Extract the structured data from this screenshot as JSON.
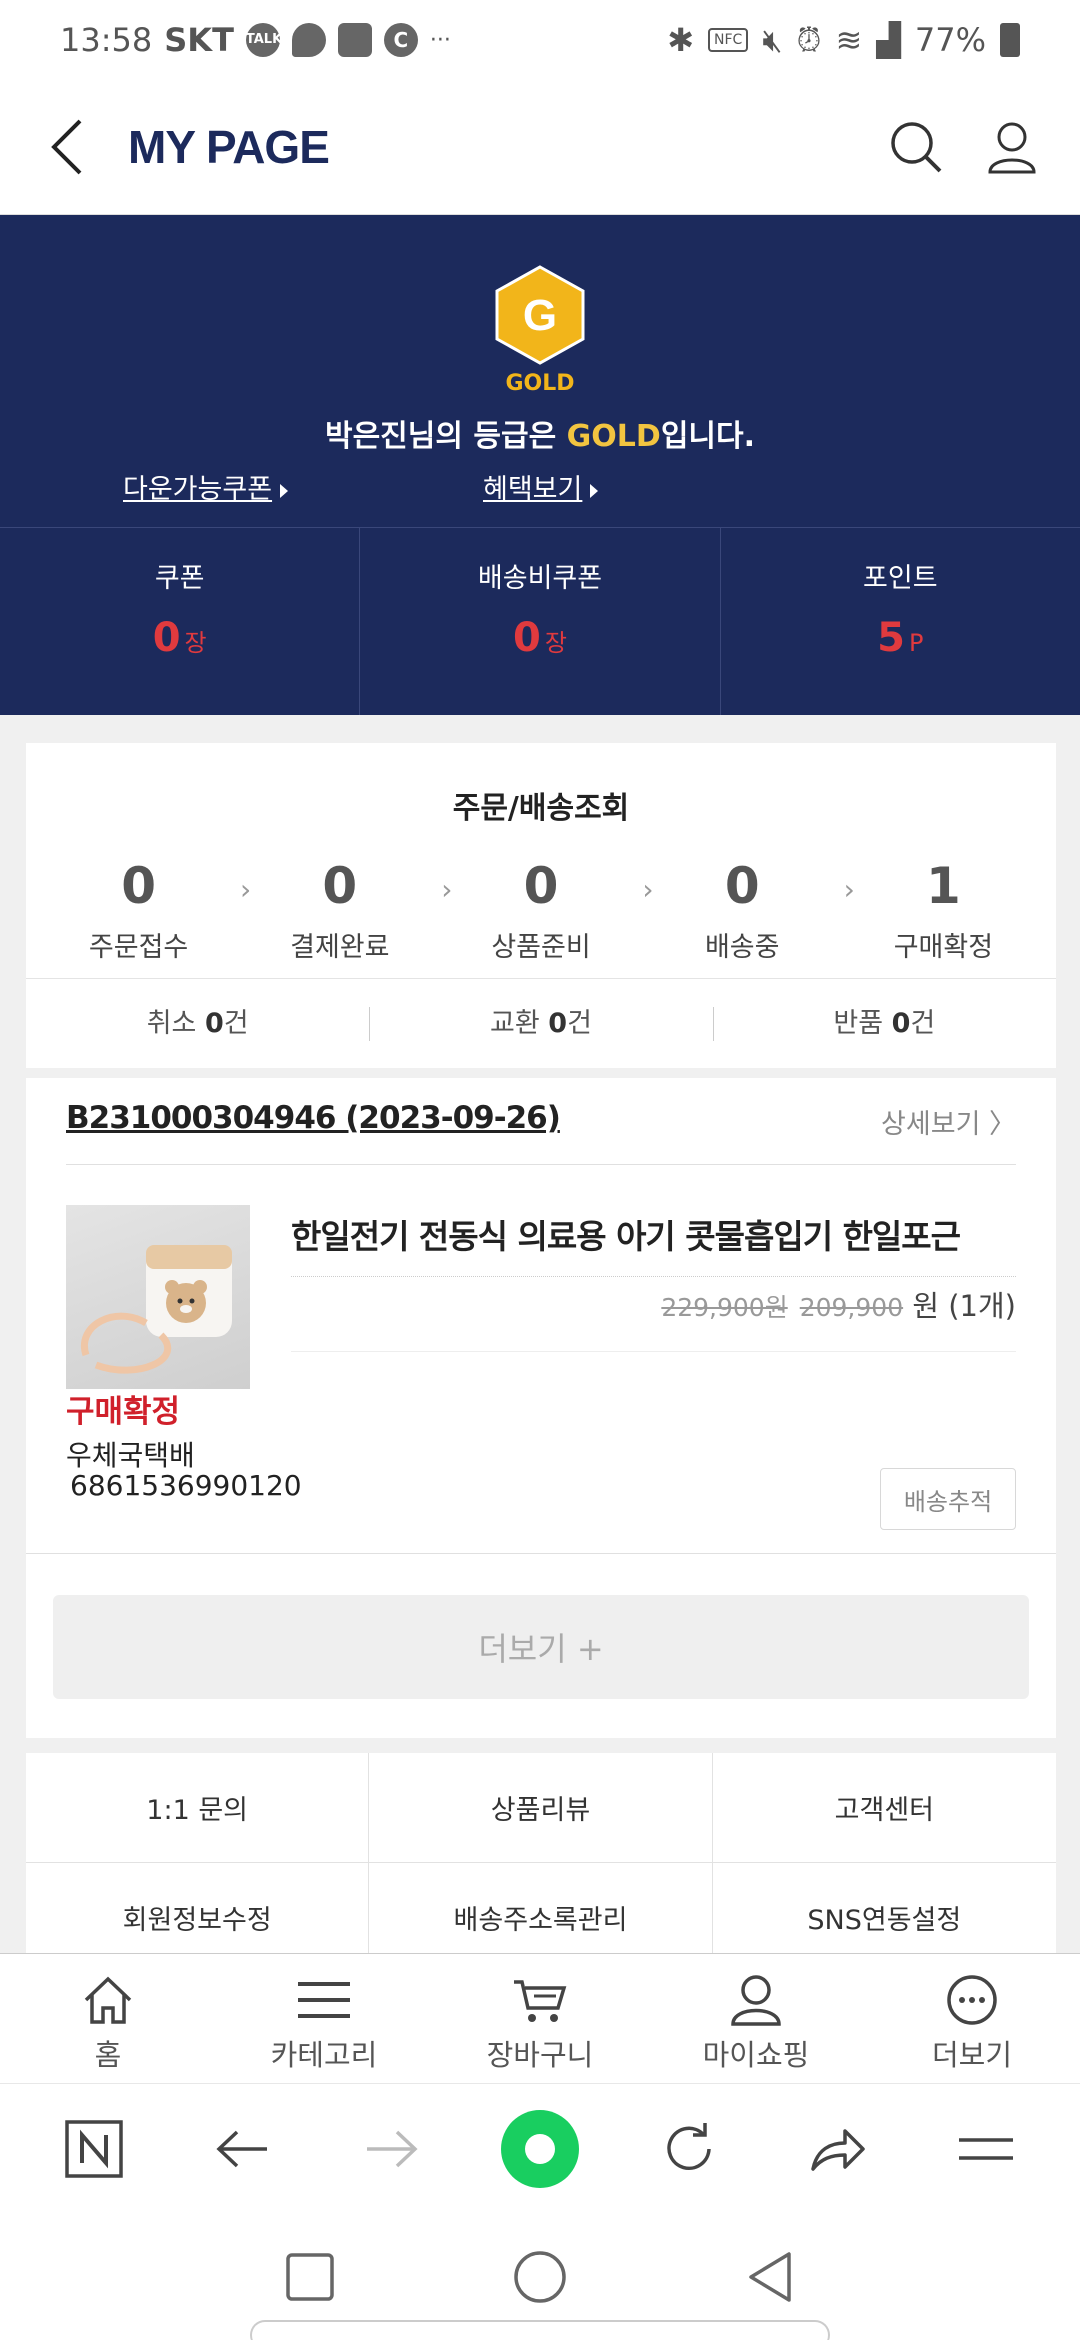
{
  "status_bar": {
    "time": "13:58",
    "carrier": "SKT",
    "notif_talk": "TALK",
    "notif_c": "C",
    "more": "···",
    "nfc": "NFC",
    "battery": "77%"
  },
  "header": {
    "title": "MY PAGE"
  },
  "membership": {
    "badge_letter": "G",
    "grade_label": "GOLD",
    "msg_prefix": "박은진님의 등급은 ",
    "msg_grade": "GOLD",
    "msg_suffix": "입니다.",
    "coupon_link": "다운가능쿠폰",
    "benefit_link": "혜택보기",
    "stats": [
      {
        "label": "쿠폰",
        "value": "0",
        "unit": "장"
      },
      {
        "label": "배송비쿠폰",
        "value": "0",
        "unit": "장"
      },
      {
        "label": "포인트",
        "value": "5",
        "unit": "P"
      }
    ]
  },
  "orders": {
    "title": "주문/배송조회",
    "steps": [
      {
        "count": "0",
        "label": "주문접수"
      },
      {
        "count": "0",
        "label": "결제완료"
      },
      {
        "count": "0",
        "label": "상품준비"
      },
      {
        "count": "0",
        "label": "배송중"
      },
      {
        "count": "1",
        "label": "구매확정"
      }
    ],
    "chevron": "›",
    "misc": [
      {
        "label": "취소 ",
        "count": "0",
        "unit": "건"
      },
      {
        "label": "교환 ",
        "count": "0",
        "unit": "건"
      },
      {
        "label": "반품 ",
        "count": "0",
        "unit": "건"
      }
    ]
  },
  "recent_order": {
    "order_no": "B231000304946 (2023-09-26)",
    "detail_link": "상세보기 〉",
    "product_name": "한일전기 전동식 의료용 아기 콧물흡입기 한일포근",
    "original_price": "229,900원",
    "sale_price": "209,900",
    "currency_qty": " 원 (1개)",
    "status": "구매확정",
    "courier": "우체국택배",
    "tracking_no": "6861536990120",
    "track_button": "배송추적",
    "more_button": "더보기 +"
  },
  "menu": [
    "1:1 문의",
    "상품리뷰",
    "고객센터",
    "회원정보수정",
    "배송주소록관리",
    "SNS연동설정"
  ],
  "bottom_nav": [
    {
      "icon": "home-icon",
      "label": "홈"
    },
    {
      "icon": "menu-icon",
      "label": "카테고리"
    },
    {
      "icon": "cart-icon",
      "label": "장바구니"
    },
    {
      "icon": "user-icon",
      "label": "마이쇼핑"
    },
    {
      "icon": "more-icon",
      "label": "더보기"
    }
  ],
  "colors": {
    "navy": "#1c2a5c",
    "accent_red": "#d0202b",
    "gold": "#f2b51a",
    "naver_green": "#19ce60"
  }
}
